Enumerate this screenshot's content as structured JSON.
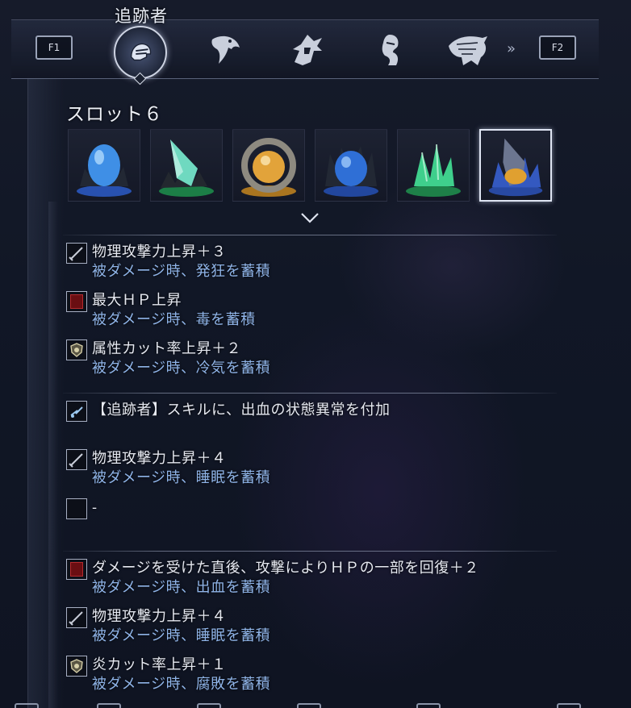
{
  "header": {
    "character_name": "追跡者",
    "prev_key": "F1",
    "next_key": "F2",
    "more_indicator": "»",
    "characters": [
      {
        "icon": "helmet-icon",
        "active": true
      },
      {
        "icon": "eagle-icon",
        "active": false
      },
      {
        "icon": "hooded-figure-icon",
        "active": false
      },
      {
        "icon": "veiled-figure-icon",
        "active": false
      },
      {
        "icon": "dragon-icon",
        "active": false
      }
    ]
  },
  "slot": {
    "title": "スロット６",
    "relics": [
      {
        "name": "blue-orb-relic",
        "color": "#3f8fe6",
        "frame": "#2c5cc8",
        "selected": false
      },
      {
        "name": "green-crystal-relic",
        "color": "#4fd6a2",
        "frame": "#1d8a4a",
        "selected": false
      },
      {
        "name": "golden-orb-relic",
        "color": "#e2a33a",
        "frame": "#c4861e",
        "selected": false
      },
      {
        "name": "dark-blue-orb-relic",
        "color": "#2f6fd6",
        "frame": "#2450b4",
        "selected": false
      },
      {
        "name": "green-shard-relic",
        "color": "#3fcf8c",
        "frame": "#1f8c4c",
        "selected": false
      },
      {
        "name": "amber-crystal-relic",
        "color": "#e0a030",
        "frame": "#2a4fb0",
        "selected": true
      }
    ]
  },
  "groups": [
    {
      "effects": [
        {
          "icon": "sword-icon",
          "main": "物理攻撃力上昇＋３",
          "sub": "被ダメージ時、発狂を蓄積"
        },
        {
          "icon": "red-square-icon",
          "main": "最大ＨＰ上昇",
          "sub": "被ダメージ時、毒を蓄積"
        },
        {
          "icon": "shield-crest-icon",
          "main": "属性カット率上昇＋２",
          "sub": "被ダメージ時、冷気を蓄積"
        }
      ]
    },
    {
      "effects": [
        {
          "icon": "skill-spark-icon",
          "main": "【追跡者】スキルに、出血の状態異常を付加",
          "sub": ""
        },
        {
          "icon": "sword-icon",
          "main": "物理攻撃力上昇＋４",
          "sub": "被ダメージ時、睡眠を蓄積"
        },
        {
          "icon": "empty-slot-icon",
          "main": "-",
          "sub": ""
        }
      ]
    },
    {
      "effects": [
        {
          "icon": "red-square-icon",
          "main": "ダメージを受けた直後、攻撃によりＨＰの一部を回復＋２",
          "sub": "被ダメージ時、出血を蓄積"
        },
        {
          "icon": "sword-icon",
          "main": "物理攻撃力上昇＋４",
          "sub": "被ダメージ時、睡眠を蓄積"
        },
        {
          "icon": "shield-crest-icon",
          "main": "炎カット率上昇＋１",
          "sub": "被ダメージ時、腐敗を蓄積"
        }
      ]
    }
  ],
  "colors": {
    "effect_text": "#e6e9f1",
    "debuff_text": "#8fb4e8",
    "frame": "#a8b0c4"
  }
}
